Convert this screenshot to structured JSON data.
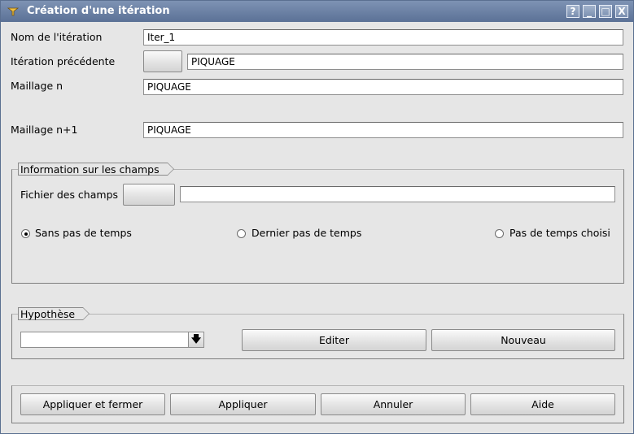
{
  "window": {
    "title": "Création d'une itération",
    "help_label": "?",
    "minimize_label": "_",
    "maximize_label": "□",
    "close_label": "X"
  },
  "form": {
    "iteration_name_label": "Nom de l'itération",
    "iteration_name_value": "Iter_1",
    "previous_iteration_label": "Itération précédente",
    "previous_iteration_value": "PIQUAGE",
    "mesh_n_label": "Maillage n",
    "mesh_n_value": "PIQUAGE",
    "mesh_n1_label": "Maillage n+1",
    "mesh_n1_value": "PIQUAGE"
  },
  "fields_group": {
    "title": "Information sur les champs",
    "file_label": "Fichier des champs",
    "file_value": "",
    "radio_no_timestep": "Sans pas de temps",
    "radio_last_timestep": "Dernier pas de temps",
    "radio_chosen_timestep": "Pas de temps choisi",
    "selected": "radio_no_timestep"
  },
  "hypothesis_group": {
    "title": "Hypothèse",
    "selected_value": "",
    "edit_label": "Editer",
    "new_label": "Nouveau"
  },
  "footer": {
    "apply_close_label": "Appliquer et fermer",
    "apply_label": "Appliquer",
    "cancel_label": "Annuler",
    "help_label": "Aide"
  }
}
